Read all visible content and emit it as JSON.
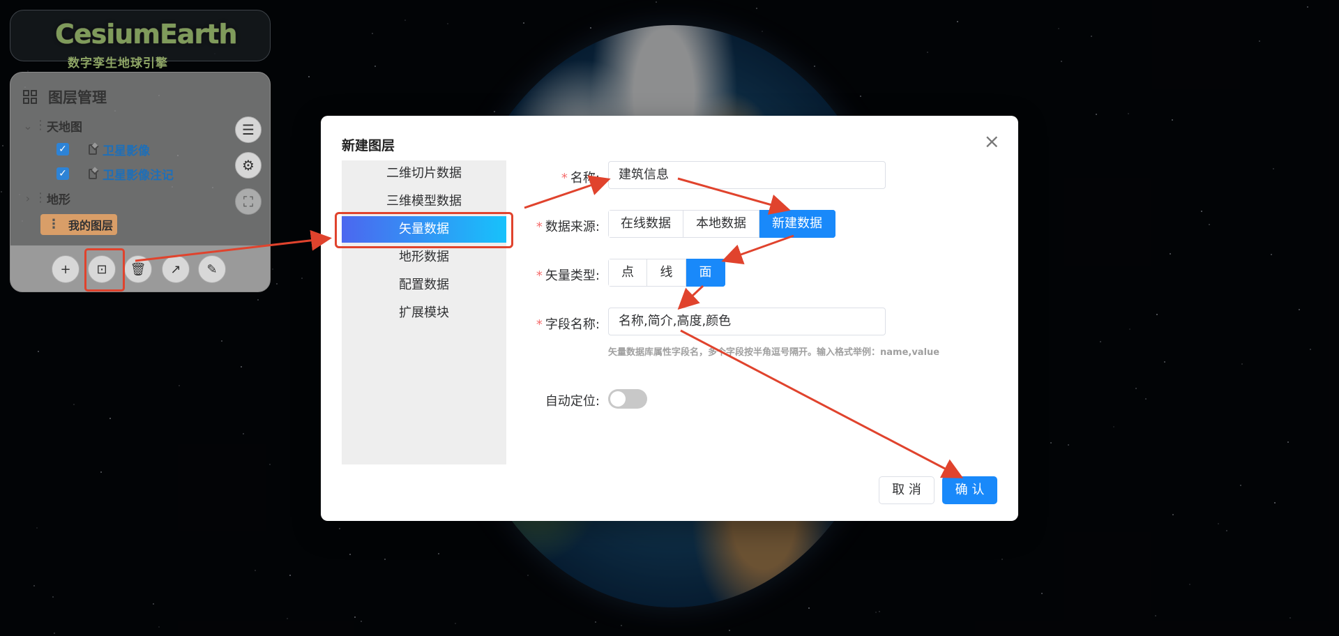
{
  "brand": {
    "title": "CesiumEarth",
    "subtitle": "数字孪生地球引擎"
  },
  "layer_panel": {
    "title": "图层管理",
    "items": [
      {
        "label": "天地图"
      },
      {
        "label": "卫星影像"
      },
      {
        "label": "卫星影像注记"
      },
      {
        "label": "地形"
      },
      {
        "label": "我的图层"
      }
    ]
  },
  "dialog": {
    "title": "新建图层",
    "menu": [
      "二维切片数据",
      "三维模型数据",
      "矢量数据",
      "地形数据",
      "配置数据",
      "扩展模块"
    ],
    "form": {
      "name_label": "名称:",
      "name_value": "建筑信息",
      "source_label": "数据来源:",
      "source_options": [
        "在线数据",
        "本地数据",
        "新建数据"
      ],
      "type_label": "矢量类型:",
      "type_options": [
        "点",
        "线",
        "面"
      ],
      "field_label": "字段名称:",
      "field_value": "名称,简介,高度,颜色",
      "hint": "矢量数据库属性字段名，多个字段按半角逗号隔开。输入格式举例：name,value",
      "auto_locate_label": "自动定位:"
    },
    "buttons": {
      "cancel": "取 消",
      "confirm": "确 认"
    }
  },
  "colors": {
    "accent": "#1989fa",
    "annotation": "#e0432d",
    "required": "#f56c6c"
  }
}
